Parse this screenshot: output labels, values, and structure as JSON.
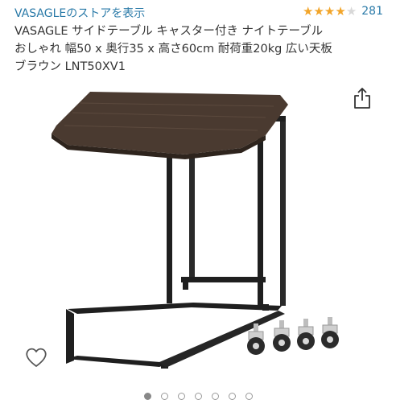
{
  "header": {
    "store_link": "VASAGLEのストアを表示",
    "rating": {
      "stars": 4,
      "max_stars": 5,
      "count": "281"
    }
  },
  "product": {
    "title_lines": [
      "VASAGLE サイドテーブル キャスター付き ナイトテーブル",
      "おしゃれ 幅50 x 奥行35 x 高さ60cm 耐荷重20kg 広い天板",
      "ブラウン LNT50XV1"
    ]
  },
  "gallery": {
    "dots": 7,
    "active_index": 0
  },
  "icons": {
    "share": "share-icon",
    "wishlist": "heart-icon",
    "star": "star-icon"
  },
  "colors": {
    "link": "#2a7aa8",
    "star": "#f2a52a",
    "tabletop": "#4a3a30",
    "frame": "#1f1f1f"
  }
}
